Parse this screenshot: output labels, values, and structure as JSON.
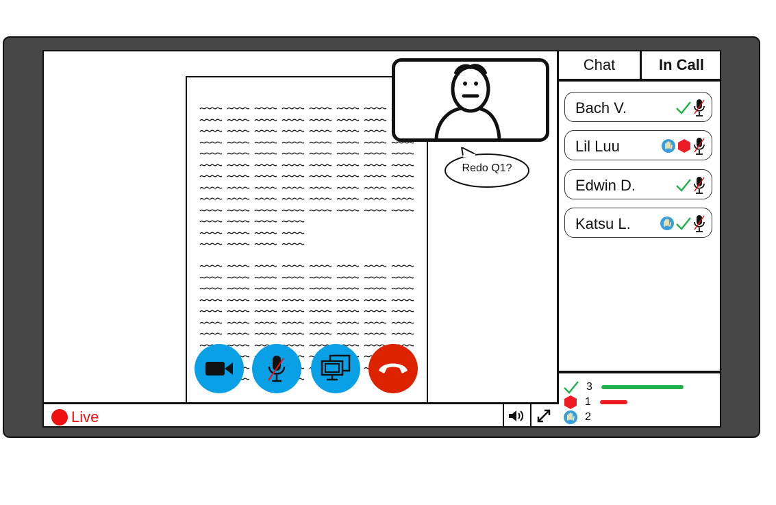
{
  "call": {
    "speech_bubble": "Redo Q1?",
    "live_label": "Live"
  },
  "tabs": [
    {
      "label": "Chat",
      "active": false
    },
    {
      "label": "In Call",
      "active": true
    }
  ],
  "participants": [
    {
      "name": "Bach V.",
      "status": [
        "check-icon",
        "mic-muted-icon"
      ]
    },
    {
      "name": "Lil Luu",
      "status": [
        "raised-hand-icon",
        "stop-hexagon-icon",
        "mic-muted-icon"
      ]
    },
    {
      "name": "Edwin D.",
      "status": [
        "check-icon",
        "mic-muted-icon"
      ]
    },
    {
      "name": "Katsu L.",
      "status": [
        "raised-hand-icon",
        "check-icon",
        "mic-muted-icon"
      ]
    }
  ],
  "summary": [
    {
      "icon": "check-icon",
      "count": "3",
      "color": "#22b14c"
    },
    {
      "icon": "stop-hexagon-icon",
      "count": "1",
      "color": "#ed1c24"
    },
    {
      "icon": "raised-hand-icon",
      "count": "2",
      "color": ""
    }
  ],
  "controls": [
    "camera-icon",
    "mic-muted-icon",
    "share-screen-icon",
    "hang-up-icon"
  ],
  "colors": {
    "accent_blue": "#0aa0e6",
    "hangup_red": "#dd2200",
    "live_red": "#ee1111",
    "check_green": "#22b14c",
    "stop_red": "#ed1c24",
    "frame": "#474747"
  }
}
